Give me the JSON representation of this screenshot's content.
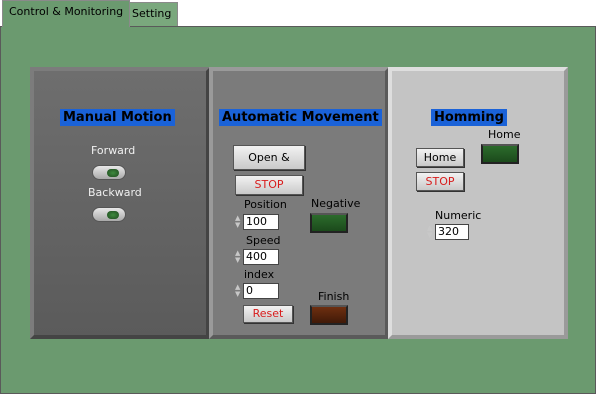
{
  "tabs": [
    {
      "label": "Control & Monitoring"
    },
    {
      "label": "Setting"
    }
  ],
  "manual": {
    "title": "Manual Motion",
    "forward_label": "Forward",
    "backward_label": "Backward"
  },
  "auto": {
    "title": "Automatic Movement",
    "open_move_label": "Open & Move",
    "stop_label": "STOP",
    "position_label": "Position",
    "position_value": "100",
    "speed_label": "Speed",
    "speed_value": "400",
    "index_label": "index",
    "index_value": "0",
    "reset_label": "Reset",
    "negative_label": "Negative",
    "finish_label": "Finish"
  },
  "home": {
    "title": "Homming",
    "home_button_label": "Home",
    "home_indicator_label": "Home",
    "stop_label": "STOP",
    "numeric_label": "Numeric",
    "numeric_value": "320"
  },
  "colors": {
    "background": "#6b9a6f",
    "title_bg": "#1a62d8",
    "led_green": "#1f4f1f",
    "led_brown": "#5a2510",
    "stop_text": "#d81c1c"
  }
}
